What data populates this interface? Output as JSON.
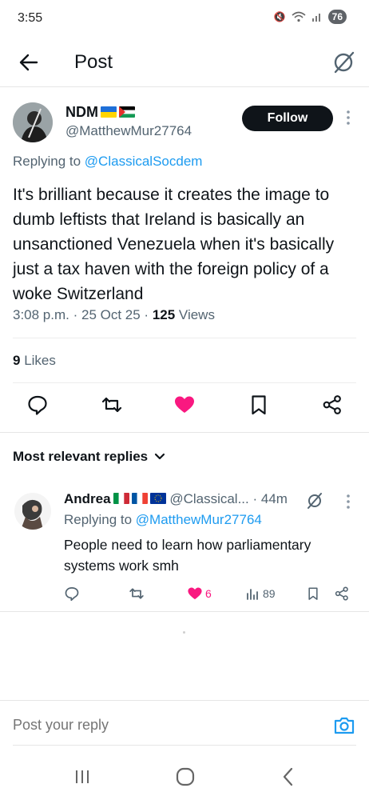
{
  "status_bar": {
    "time": "3:55",
    "battery": "76"
  },
  "header": {
    "title": "Post"
  },
  "post": {
    "author_name": "NDM",
    "author_handle": "@MatthewMur27764",
    "follow_label": "Follow",
    "replying_prefix": "Replying to",
    "replying_handle": "@ClassicalSocdem",
    "text": "It's brilliant because it creates the image to dumb leftists that Ireland is basically an unsanctioned Venezuela when it's basically just a tax haven with the foreign policy of a woke Switzerland",
    "time": "3:08 p.m.",
    "date": "25 Oct 25",
    "views_count": "125",
    "views_label": "Views",
    "likes_count": "9",
    "likes_label": "Likes"
  },
  "replies_section": {
    "label": "Most relevant replies"
  },
  "reply": {
    "author_name": "Andrea",
    "author_handle": "@Classical...",
    "age": "44m",
    "replying_prefix": "Replying to",
    "replying_handle": "@MatthewMur27764",
    "text": "People need to learn how parliamentary systems work smh",
    "likes": "6",
    "views": "89"
  },
  "composer": {
    "placeholder": "Post your reply"
  },
  "colors": {
    "accent": "#1d9bf0",
    "like": "#f91880",
    "text": "#0f1419",
    "muted": "#536471"
  },
  "icons": [
    "back-arrow-icon",
    "grok-icon",
    "reply-icon",
    "repost-icon",
    "heart-icon",
    "bookmark-icon",
    "share-icon",
    "views-icon",
    "camera-icon",
    "chevron-down-icon"
  ]
}
